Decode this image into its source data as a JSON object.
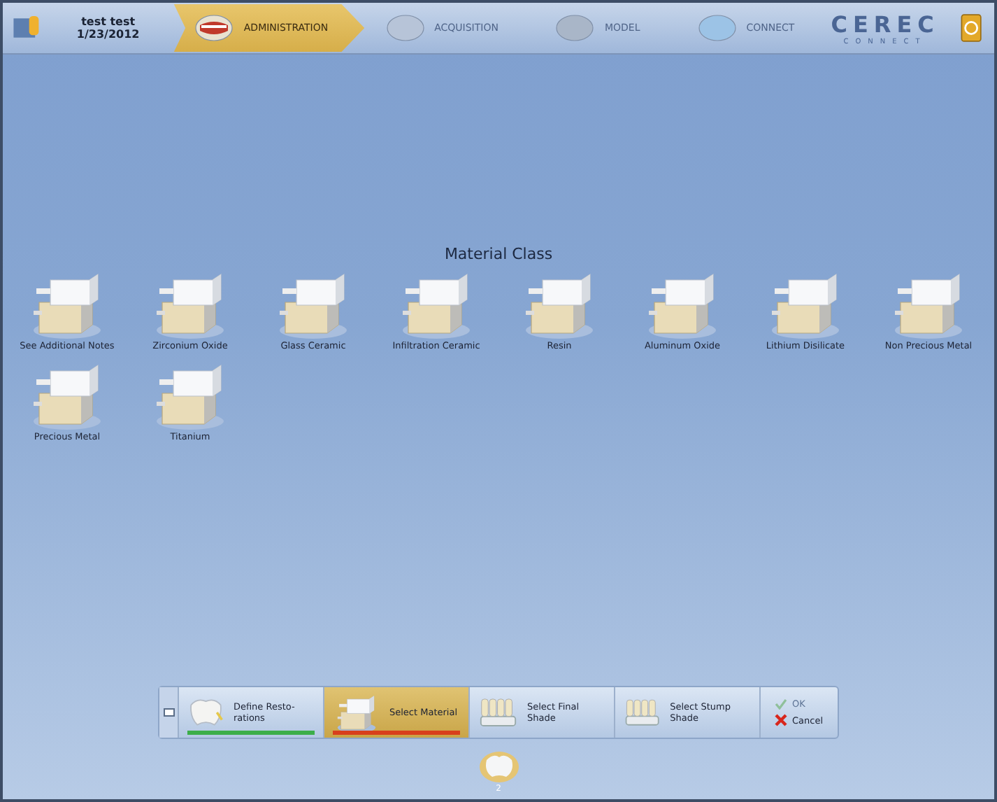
{
  "header": {
    "patient": "test test",
    "date": "1/23/2012",
    "phases": [
      {
        "label": "ADMINISTRATION",
        "selected": true
      },
      {
        "label": "ACQUISITION",
        "selected": false
      },
      {
        "label": "MODEL",
        "selected": false
      },
      {
        "label": "CONNECT",
        "selected": false
      }
    ],
    "logo": {
      "title": "CEREC",
      "subtitle": "CONNECT"
    }
  },
  "title": "Material Class",
  "materials": [
    "See Additional Notes",
    "Zirconium Oxide",
    "Glass Ceramic",
    "Infiltration Ceramic",
    "Resin",
    "Aluminum Oxide",
    "Lithium Disilicate",
    "Non Precious Metal",
    "Precious Metal",
    "Titanium"
  ],
  "steps": [
    {
      "label": "Define Resto-rations",
      "selected": false,
      "color": "#3cae4a",
      "kind": "tooth"
    },
    {
      "label": "Select Material",
      "selected": true,
      "color": "#d8401c",
      "kind": "block"
    },
    {
      "label": "Select Final Shade",
      "selected": false,
      "kind": "shade"
    },
    {
      "label": "Select Stump Shade",
      "selected": false,
      "kind": "shade"
    }
  ],
  "actions": [
    {
      "label": "OK",
      "disabled": true,
      "kind": "ok"
    },
    {
      "label": "Cancel",
      "disabled": false,
      "kind": "cancel"
    }
  ],
  "tooth": {
    "label": "2"
  }
}
